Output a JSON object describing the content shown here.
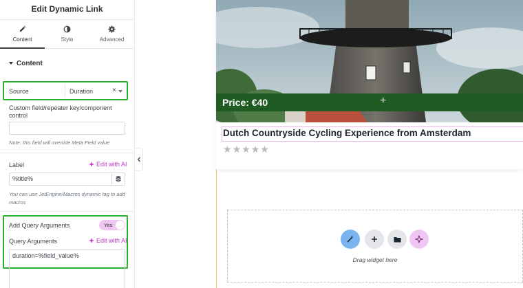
{
  "panel": {
    "title": "Edit Dynamic Link",
    "tabs": [
      {
        "label": "Content",
        "icon": "pencil-icon"
      },
      {
        "label": "Style",
        "icon": "half-circle-icon"
      },
      {
        "label": "Advanced",
        "icon": "gear-icon"
      }
    ],
    "section_title": "Content",
    "source": {
      "label": "Source",
      "value": "Duration"
    },
    "custom_field": {
      "label": "Custom field/repeater key/component control",
      "value": "",
      "note": "Note: this field will override Meta Field value"
    },
    "label_field": {
      "label": "Label",
      "ai_label": "Edit with AI",
      "value": "%title%",
      "note": "You can use JetEngine/Macros dynamic tag to add macros"
    },
    "add_query": {
      "label": "Add Query Arguments",
      "toggle_label": "Yes"
    },
    "query_args": {
      "label": "Query Arguments",
      "ai_label": "Edit with AI",
      "value": "duration=%field_value%"
    }
  },
  "card": {
    "price": "Price: €40",
    "title": "Dutch Countryside Cycling Experience from Amsterdam",
    "rating_stars": 5
  },
  "dropzone": {
    "text": "Drag widget here"
  },
  "colors": {
    "accent_green": "#2bb02b",
    "price_bar": "#1f5b23",
    "ai_pink": "#c036c4",
    "toggle_bg": "#f0c7f2"
  }
}
